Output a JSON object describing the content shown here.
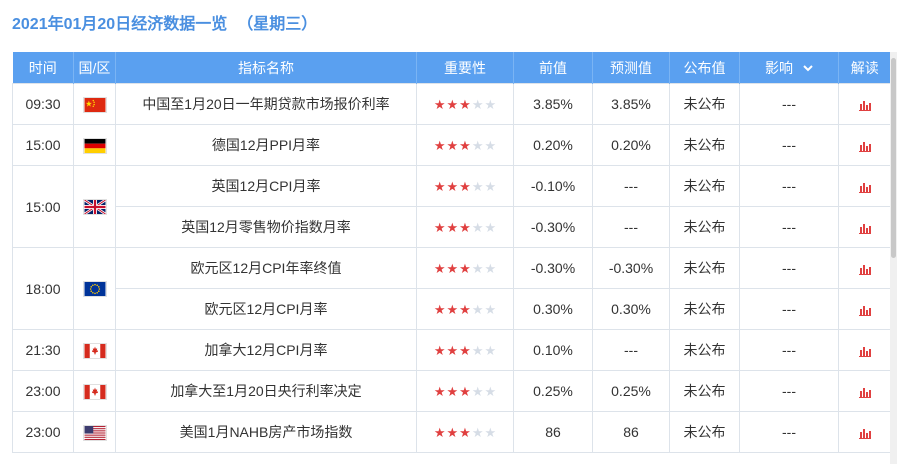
{
  "page": {
    "title": "2021年01月20日经济数据一览",
    "weekday": "（星期三）"
  },
  "header": {
    "time": "时间",
    "country": "国/区",
    "indicator": "指标名称",
    "importance": "重要性",
    "previous": "前值",
    "forecast": "预测值",
    "actual": "公布值",
    "effect": "影响",
    "analysis": "解读"
  },
  "colors": {
    "accent": "#5aa0f0",
    "title": "#4a8fe0",
    "value_red": "#e04040"
  },
  "rows": [
    {
      "time": "09:30",
      "country_icon": "china-flag-icon",
      "name": "中国至1月20日一年期贷款市场报价利率",
      "importance": 3,
      "previous": "3.85%",
      "forecast": "3.85%",
      "actual": "未公布",
      "effect": "---"
    },
    {
      "time": "15:00",
      "country_icon": "germany-flag-icon",
      "name": "德国12月PPI月率",
      "importance": 3,
      "previous": "0.20%",
      "forecast": "0.20%",
      "actual": "未公布",
      "effect": "---"
    },
    {
      "time": "15:00",
      "country_icon": "uk-flag-icon",
      "name": "英国12月CPI月率",
      "importance": 3,
      "previous": "-0.10%",
      "forecast": "---",
      "actual": "未公布",
      "effect": "---"
    },
    {
      "name": "英国12月零售物价指数月率",
      "importance": 3,
      "previous": "-0.30%",
      "forecast": "---",
      "actual": "未公布",
      "effect": "---"
    },
    {
      "time": "18:00",
      "country_icon": "eu-flag-icon",
      "name": "欧元区12月CPI年率终值",
      "importance": 3,
      "previous": "-0.30%",
      "forecast": "-0.30%",
      "actual": "未公布",
      "effect": "---"
    },
    {
      "name": "欧元区12月CPI月率",
      "importance": 3,
      "previous": "0.30%",
      "forecast": "0.30%",
      "actual": "未公布",
      "effect": "---"
    },
    {
      "time": "21:30",
      "country_icon": "canada-flag-icon",
      "name": "加拿大12月CPI月率",
      "importance": 3,
      "previous": "0.10%",
      "forecast": "---",
      "actual": "未公布",
      "effect": "---"
    },
    {
      "time": "23:00",
      "country_icon": "canada-flag-icon",
      "name": "加拿大至1月20日央行利率决定",
      "importance": 3,
      "previous": "0.25%",
      "forecast": "0.25%",
      "actual": "未公布",
      "effect": "---"
    },
    {
      "time": "23:00",
      "country_icon": "usa-flag-icon",
      "name": "美国1月NAHB房产市场指数",
      "importance": 3,
      "previous": "86",
      "forecast": "86",
      "actual": "未公布",
      "effect": "---"
    }
  ]
}
